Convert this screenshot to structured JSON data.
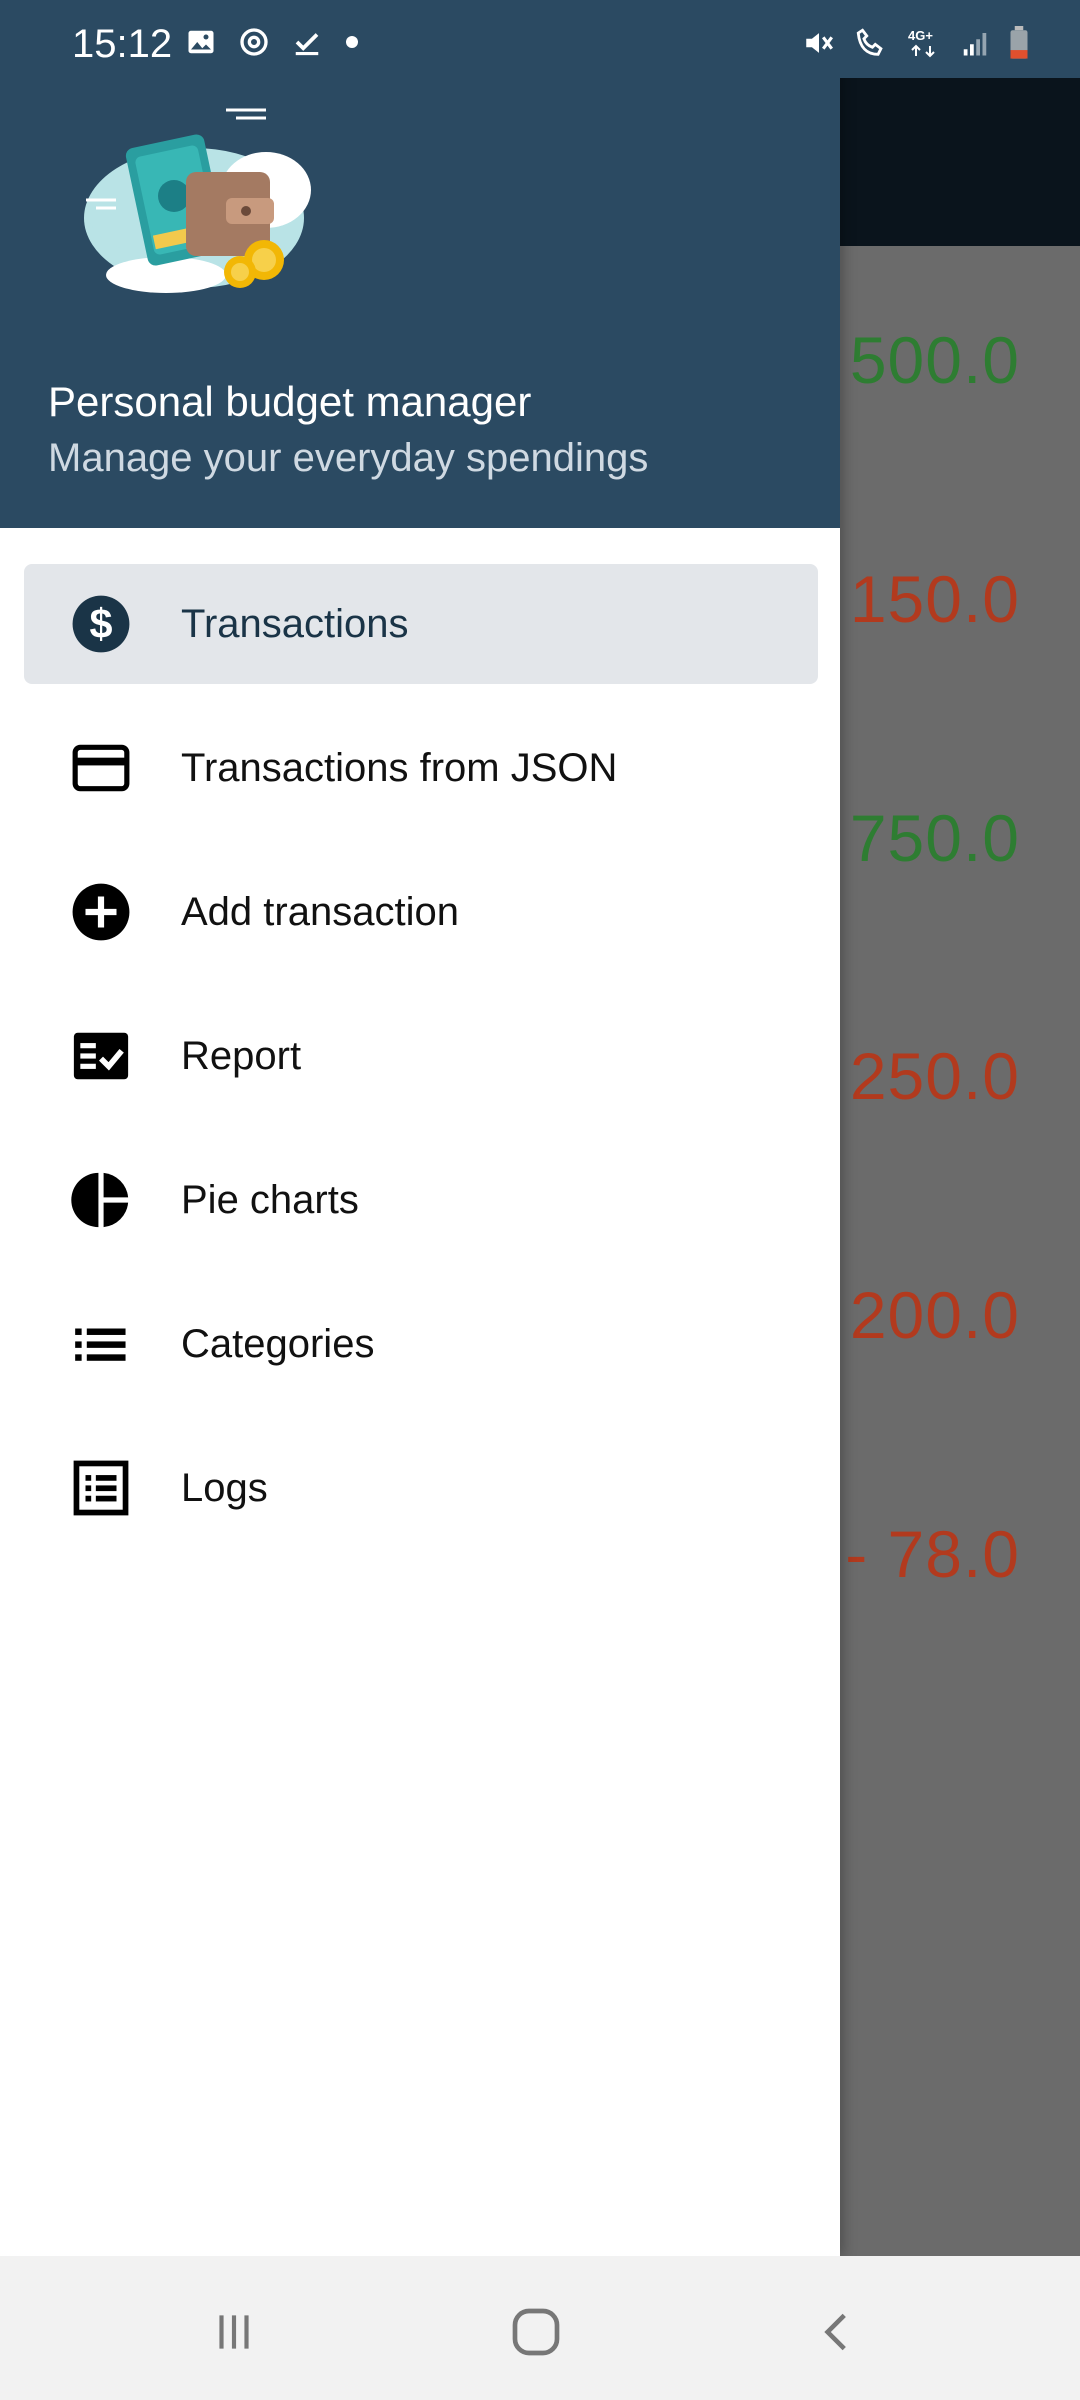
{
  "status_bar": {
    "time": "15:12",
    "left_icons": [
      "gallery-icon",
      "sync-icon",
      "download-done-icon",
      "dot-icon"
    ],
    "right_icons": [
      "mute-icon",
      "wifi-calling-icon",
      "network-4g-icon",
      "signal-icon",
      "battery-icon"
    ],
    "network_label": "4G+"
  },
  "drawer": {
    "title": "Personal budget manager",
    "subtitle": "Manage your everyday spendings",
    "items": [
      {
        "label": "Transactions",
        "icon": "dollar-circle-icon",
        "active": true
      },
      {
        "label": "Transactions from JSON",
        "icon": "credit-card-icon",
        "active": false
      },
      {
        "label": "Add transaction",
        "icon": "add-circle-icon",
        "active": false
      },
      {
        "label": "Report",
        "icon": "checklist-icon",
        "active": false
      },
      {
        "label": "Pie charts",
        "icon": "pie-chart-icon",
        "active": false
      },
      {
        "label": "Categories",
        "icon": "list-icon",
        "active": false
      },
      {
        "label": "Logs",
        "icon": "log-list-icon",
        "active": false
      }
    ]
  },
  "background_list": {
    "amounts": [
      {
        "text": "500.0",
        "color": "#2e7d32"
      },
      {
        "text": "150.0",
        "color": "#b23a1e"
      },
      {
        "text": "750.0",
        "color": "#2e7d32"
      },
      {
        "text": "250.0",
        "color": "#b23a1e"
      },
      {
        "text": "200.0",
        "color": "#b23a1e"
      },
      {
        "text": "- 78.0",
        "color": "#b23a1e"
      }
    ]
  },
  "colors": {
    "header_bg": "#2b4a62",
    "active_item_bg": "#e3e6ea",
    "scrim": "#6b6b6b"
  }
}
